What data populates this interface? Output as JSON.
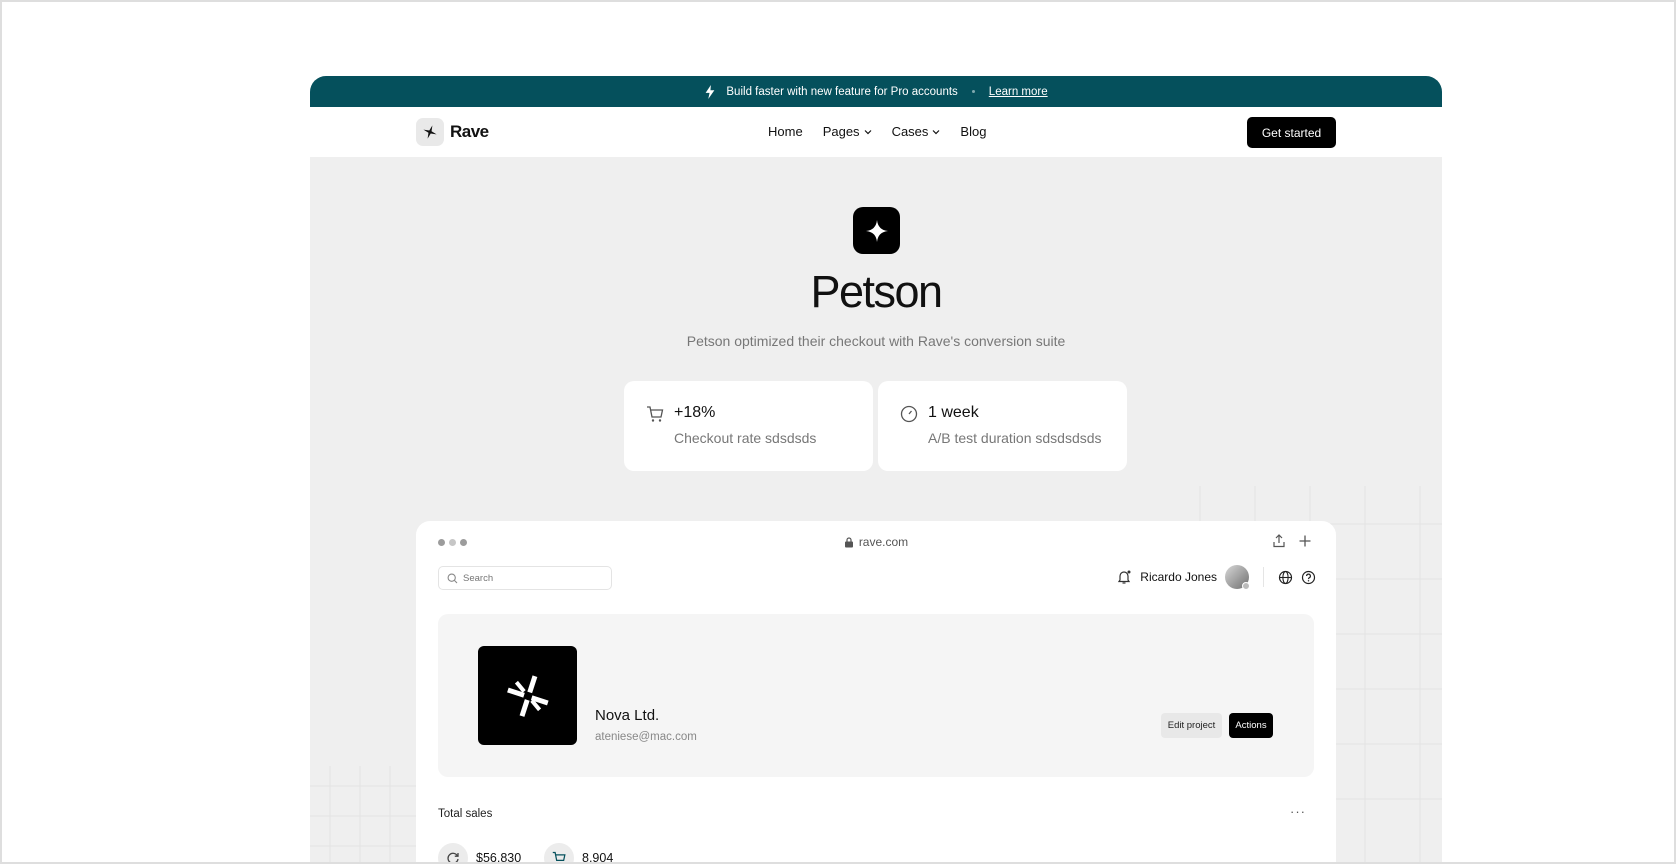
{
  "announcement": {
    "icon": "lightning-icon",
    "text": "Build faster with new feature for Pro accounts",
    "link": "Learn more"
  },
  "nav": {
    "brand": "Rave",
    "items": [
      {
        "label": "Home",
        "dropdown": false
      },
      {
        "label": "Pages",
        "dropdown": true
      },
      {
        "label": "Cases",
        "dropdown": true
      },
      {
        "label": "Blog",
        "dropdown": false
      }
    ],
    "cta": "Get started"
  },
  "hero": {
    "icon": "sparkle-icon",
    "title": "Petson",
    "subtitle": "Petson optimized their checkout with Rave's conversion suite"
  },
  "stats": [
    {
      "icon": "cart-icon",
      "value": "+18%",
      "label": "Checkout rate sdsdsds"
    },
    {
      "icon": "clock-icon",
      "value": "1 week",
      "label": "A/B test duration sdsdsdsds"
    }
  ],
  "browser": {
    "url": "rave.com",
    "search_placeholder": "Search",
    "user_name": "Ricardo Jones",
    "project": {
      "name": "Nova Ltd.",
      "email": "ateniese@mac.com",
      "edit_label": "Edit project",
      "actions_label": "Actions"
    },
    "sales": {
      "title": "Total sales",
      "more": "···",
      "metrics": [
        {
          "icon": "refresh-icon",
          "value": "$56,830"
        },
        {
          "icon": "cart-icon",
          "value": "8,904"
        }
      ]
    }
  },
  "colors": {
    "announcement_bg": "#05505c",
    "page_bg": "#efefef",
    "primary": "#000000"
  }
}
